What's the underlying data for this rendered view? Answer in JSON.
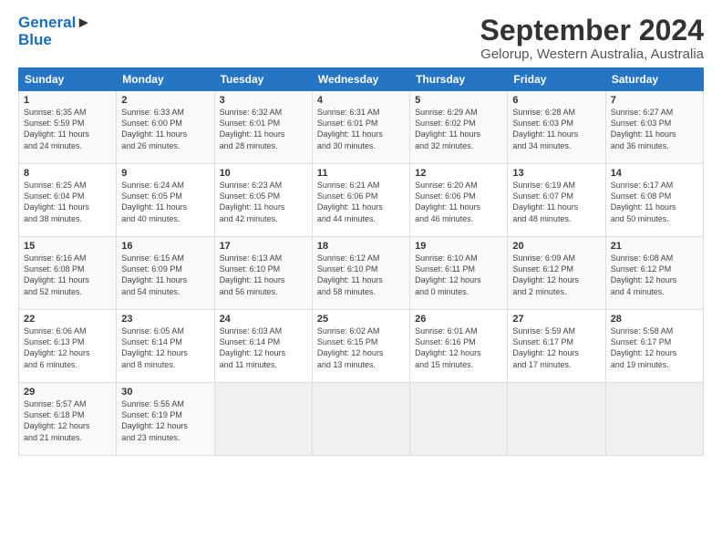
{
  "header": {
    "logo_line1": "General",
    "logo_line2": "Blue",
    "title": "September 2024",
    "subtitle": "Gelorup, Western Australia, Australia"
  },
  "weekdays": [
    "Sunday",
    "Monday",
    "Tuesday",
    "Wednesday",
    "Thursday",
    "Friday",
    "Saturday"
  ],
  "weeks": [
    [
      {
        "day": "1",
        "info": "Sunrise: 6:35 AM\nSunset: 5:59 PM\nDaylight: 11 hours\nand 24 minutes."
      },
      {
        "day": "2",
        "info": "Sunrise: 6:33 AM\nSunset: 6:00 PM\nDaylight: 11 hours\nand 26 minutes."
      },
      {
        "day": "3",
        "info": "Sunrise: 6:32 AM\nSunset: 6:01 PM\nDaylight: 11 hours\nand 28 minutes."
      },
      {
        "day": "4",
        "info": "Sunrise: 6:31 AM\nSunset: 6:01 PM\nDaylight: 11 hours\nand 30 minutes."
      },
      {
        "day": "5",
        "info": "Sunrise: 6:29 AM\nSunset: 6:02 PM\nDaylight: 11 hours\nand 32 minutes."
      },
      {
        "day": "6",
        "info": "Sunrise: 6:28 AM\nSunset: 6:03 PM\nDaylight: 11 hours\nand 34 minutes."
      },
      {
        "day": "7",
        "info": "Sunrise: 6:27 AM\nSunset: 6:03 PM\nDaylight: 11 hours\nand 36 minutes."
      }
    ],
    [
      {
        "day": "8",
        "info": "Sunrise: 6:25 AM\nSunset: 6:04 PM\nDaylight: 11 hours\nand 38 minutes."
      },
      {
        "day": "9",
        "info": "Sunrise: 6:24 AM\nSunset: 6:05 PM\nDaylight: 11 hours\nand 40 minutes."
      },
      {
        "day": "10",
        "info": "Sunrise: 6:23 AM\nSunset: 6:05 PM\nDaylight: 11 hours\nand 42 minutes."
      },
      {
        "day": "11",
        "info": "Sunrise: 6:21 AM\nSunset: 6:06 PM\nDaylight: 11 hours\nand 44 minutes."
      },
      {
        "day": "12",
        "info": "Sunrise: 6:20 AM\nSunset: 6:06 PM\nDaylight: 11 hours\nand 46 minutes."
      },
      {
        "day": "13",
        "info": "Sunrise: 6:19 AM\nSunset: 6:07 PM\nDaylight: 11 hours\nand 48 minutes."
      },
      {
        "day": "14",
        "info": "Sunrise: 6:17 AM\nSunset: 6:08 PM\nDaylight: 11 hours\nand 50 minutes."
      }
    ],
    [
      {
        "day": "15",
        "info": "Sunrise: 6:16 AM\nSunset: 6:08 PM\nDaylight: 11 hours\nand 52 minutes."
      },
      {
        "day": "16",
        "info": "Sunrise: 6:15 AM\nSunset: 6:09 PM\nDaylight: 11 hours\nand 54 minutes."
      },
      {
        "day": "17",
        "info": "Sunrise: 6:13 AM\nSunset: 6:10 PM\nDaylight: 11 hours\nand 56 minutes."
      },
      {
        "day": "18",
        "info": "Sunrise: 6:12 AM\nSunset: 6:10 PM\nDaylight: 11 hours\nand 58 minutes."
      },
      {
        "day": "19",
        "info": "Sunrise: 6:10 AM\nSunset: 6:11 PM\nDaylight: 12 hours\nand 0 minutes."
      },
      {
        "day": "20",
        "info": "Sunrise: 6:09 AM\nSunset: 6:12 PM\nDaylight: 12 hours\nand 2 minutes."
      },
      {
        "day": "21",
        "info": "Sunrise: 6:08 AM\nSunset: 6:12 PM\nDaylight: 12 hours\nand 4 minutes."
      }
    ],
    [
      {
        "day": "22",
        "info": "Sunrise: 6:06 AM\nSunset: 6:13 PM\nDaylight: 12 hours\nand 6 minutes."
      },
      {
        "day": "23",
        "info": "Sunrise: 6:05 AM\nSunset: 6:14 PM\nDaylight: 12 hours\nand 8 minutes."
      },
      {
        "day": "24",
        "info": "Sunrise: 6:03 AM\nSunset: 6:14 PM\nDaylight: 12 hours\nand 11 minutes."
      },
      {
        "day": "25",
        "info": "Sunrise: 6:02 AM\nSunset: 6:15 PM\nDaylight: 12 hours\nand 13 minutes."
      },
      {
        "day": "26",
        "info": "Sunrise: 6:01 AM\nSunset: 6:16 PM\nDaylight: 12 hours\nand 15 minutes."
      },
      {
        "day": "27",
        "info": "Sunrise: 5:59 AM\nSunset: 6:17 PM\nDaylight: 12 hours\nand 17 minutes."
      },
      {
        "day": "28",
        "info": "Sunrise: 5:58 AM\nSunset: 6:17 PM\nDaylight: 12 hours\nand 19 minutes."
      }
    ],
    [
      {
        "day": "29",
        "info": "Sunrise: 5:57 AM\nSunset: 6:18 PM\nDaylight: 12 hours\nand 21 minutes."
      },
      {
        "day": "30",
        "info": "Sunrise: 5:55 AM\nSunset: 6:19 PM\nDaylight: 12 hours\nand 23 minutes."
      },
      {
        "day": "",
        "info": ""
      },
      {
        "day": "",
        "info": ""
      },
      {
        "day": "",
        "info": ""
      },
      {
        "day": "",
        "info": ""
      },
      {
        "day": "",
        "info": ""
      }
    ]
  ]
}
